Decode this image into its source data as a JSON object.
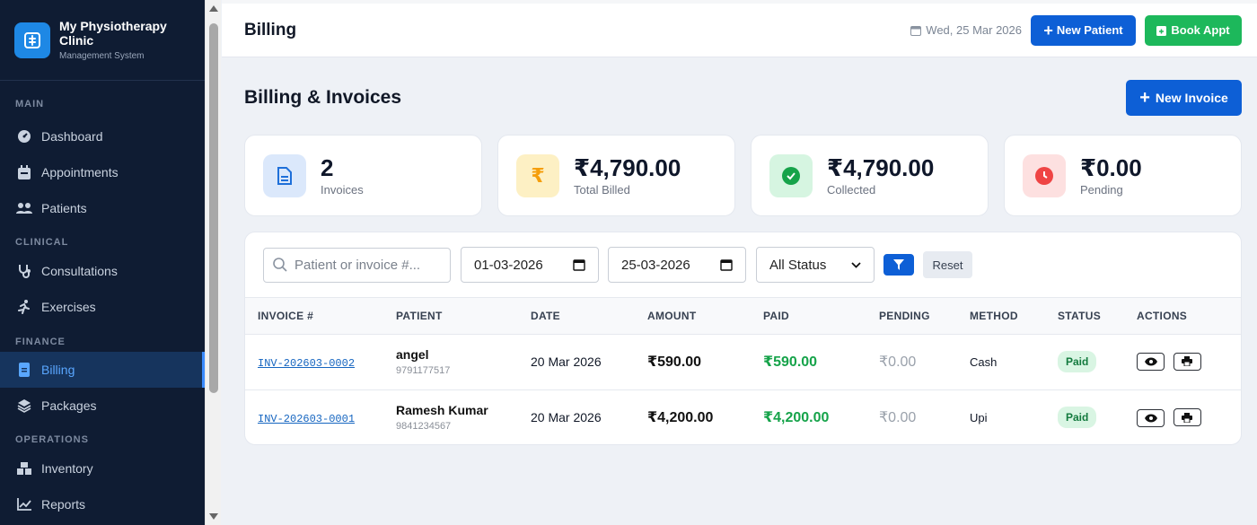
{
  "sidebar": {
    "brand_title": "My Physiotherapy Clinic",
    "brand_subtitle": "Management System",
    "sections": {
      "main": "MAIN",
      "clinical": "CLINICAL",
      "finance": "FINANCE",
      "operations": "OPERATIONS"
    },
    "items": {
      "dashboard": "Dashboard",
      "appointments": "Appointments",
      "patients": "Patients",
      "consultations": "Consultations",
      "exercises": "Exercises",
      "billing": "Billing",
      "packages": "Packages",
      "inventory": "Inventory",
      "reports": "Reports"
    },
    "active_item": "billing"
  },
  "header": {
    "title": "Billing",
    "date": "Wed, 25 Mar 2026",
    "new_patient_label": "New Patient",
    "book_appt_label": "Book Appt"
  },
  "main": {
    "title": "Billing & Invoices",
    "new_invoice_label": "New Invoice"
  },
  "stats": [
    {
      "value": "2",
      "label": "Invoices",
      "icon": "document-icon",
      "color": "#1e6fd9",
      "bg": "#dbe8fb"
    },
    {
      "value": "₹4,790.00",
      "label": "Total Billed",
      "icon": "rupee-icon",
      "color": "#f59e0b",
      "bg": "#fdf0c4"
    },
    {
      "value": "₹4,790.00",
      "label": "Collected",
      "icon": "check-circle-icon",
      "color": "#16a34a",
      "bg": "#d6f5e1"
    },
    {
      "value": "₹0.00",
      "label": "Pending",
      "icon": "clock-icon",
      "color": "#ef4444",
      "bg": "#fde0e0"
    }
  ],
  "filters": {
    "search_placeholder": "Patient or invoice #...",
    "date_from": "01-03-2026",
    "date_to": "25-03-2026",
    "status": "All Status",
    "reset_label": "Reset"
  },
  "table": {
    "columns": [
      "INVOICE #",
      "PATIENT",
      "DATE",
      "AMOUNT",
      "PAID",
      "PENDING",
      "METHOD",
      "STATUS",
      "ACTIONS"
    ],
    "rows": [
      {
        "invoice": "INV-202603-0002",
        "patient": "angel",
        "phone": "9791177517",
        "date": "20 Mar 2026",
        "amount": "₹590.00",
        "paid": "₹590.00",
        "pending": "₹0.00",
        "method": "Cash",
        "status": "Paid"
      },
      {
        "invoice": "INV-202603-0001",
        "patient": "Ramesh Kumar",
        "phone": "9841234567",
        "date": "20 Mar 2026",
        "amount": "₹4,200.00",
        "paid": "₹4,200.00",
        "pending": "₹0.00",
        "method": "Upi",
        "status": "Paid"
      }
    ]
  }
}
